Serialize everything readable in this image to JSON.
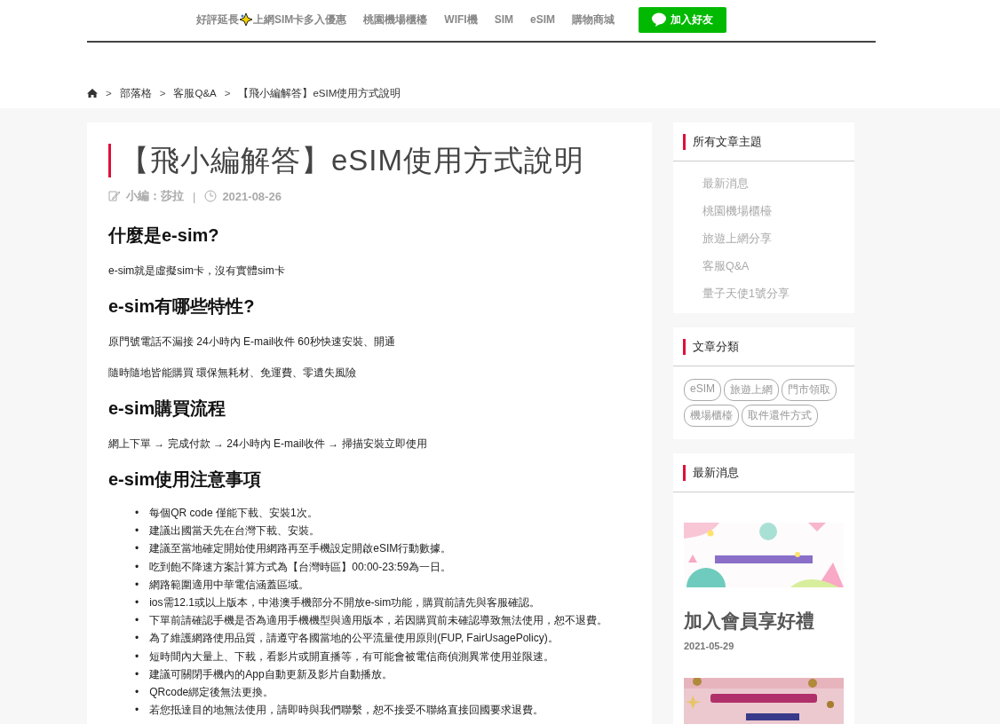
{
  "nav": {
    "items": [
      {
        "kind": "promo",
        "text": "好評延長",
        "text_2": "上網SIM卡多入優惠"
      },
      {
        "kind": "plain",
        "text": "桃園機場櫃檯"
      },
      {
        "kind": "plain",
        "text": "WIFI機"
      },
      {
        "kind": "plain",
        "text": "SIM"
      },
      {
        "kind": "plain",
        "text": "eSIM"
      },
      {
        "kind": "plain",
        "text": "購物商城"
      }
    ],
    "line_button": {
      "label": "加入好友"
    }
  },
  "breadcrumb": {
    "separator": ">",
    "items": [
      "部落格",
      "客服Q&A",
      "【飛小編解答】eSIM使用方式說明"
    ]
  },
  "article": {
    "title": "【飛小編解答】eSIM使用方式說明",
    "author": "小編：莎拉",
    "meta_separator": "|",
    "date": "2021-08-26",
    "blocks": [
      {
        "kind": "heading",
        "text": "什麼是e-sim?"
      },
      {
        "kind": "paragraph",
        "text": "e-sim就是虛擬sim卡，沒有實體sim卡"
      },
      {
        "kind": "heading",
        "text": "e-sim有哪些特性?"
      },
      {
        "kind": "paragraph",
        "text": "原門號電話不漏接 24小時內 E-mail收件 60秒快速安裝、開通"
      },
      {
        "kind": "paragraph",
        "text": "隨時隨地皆能購買 環保無耗材、免運費、零遺失風險"
      },
      {
        "kind": "heading",
        "text": "e-sim購買流程"
      },
      {
        "kind": "paragraph",
        "text": "網上下單 → 完成付款 → 24小時內 E-mail收件 → 掃描安裝立即使用"
      },
      {
        "kind": "heading",
        "text": "e-sim使用注意事項"
      },
      {
        "kind": "list",
        "marker": "•",
        "items": [
          "每個QR code 僅能下載、安裝1次。",
          "建議出國當天先在台灣下載、安裝。",
          "建議至當地確定開始使用網路再至手機設定開啟eSIM行動數據。",
          "吃到飽不降速方案計算方式為【台灣時區】00:00-23:59為一日。",
          "網路範圍適用中華電信涵蓋區域。",
          " ios需12.1或以上版本，中港澳手機部分不開放e-sim功能，購買前請先與客服確認。",
          "下單前請確認手機是否為適用手機機型與適用版本，若因購買前未確認導致無法使用，恕不退費。",
          "為了維護網路使用品質，請遵守各國當地的公平流量使用原則(FUP, FairUsagePolicy)。",
          "短時間內大量上、下載，看影片或開直播等，有可能會被電信商偵測異常使用並限速。",
          "建議可關閉手機內的App自動更新及影片自動播放。",
          "QRcode綁定後無法更換。",
          "若您抵達目的地無法使用，請即時與我們聯繫，恕不接受不聯絡直接回國要求退費。"
        ]
      }
    ]
  },
  "sidebar": [
    {
      "kind": "links",
      "title": "所有文章主題",
      "items": [
        "最新消息",
        "桃園機場櫃檯",
        "旅遊上網分享",
        "客服Q&A",
        "量子天使1號分享"
      ]
    },
    {
      "kind": "tags",
      "title": "文章分類",
      "tags": [
        "eSIM",
        "旅遊上網",
        "門市領取",
        "機場櫃檯",
        "取件還件方式"
      ]
    },
    {
      "kind": "news",
      "title": "最新消息",
      "posts": [
        {
          "kind": "picture",
          "title": "加入會員享好禮",
          "date": "2021-05-29"
        },
        {
          "kind": "picture"
        }
      ]
    }
  ]
}
